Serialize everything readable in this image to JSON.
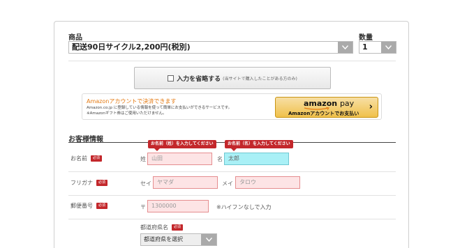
{
  "product": {
    "label": "商品",
    "selected": "配送90日サイクル2,200円(税別)"
  },
  "quantity": {
    "label": "数量",
    "selected": "1"
  },
  "skip": {
    "label": "入力を省略する",
    "note": "(当サイトで購入したことがある方のみ)"
  },
  "amazon": {
    "title": "Amazonアカウントで決済できます",
    "desc1": "Amazon.co.jp に登録している情報を使って簡単にお支払いができるサービスです。",
    "desc2": "※Amazonギフト券はご使用いただけません。",
    "button_logo_a": "amazon",
    "button_logo_b": "pay",
    "button_sub": "Amazonアカウントでお支払い",
    "button_chevron": "›"
  },
  "customer": {
    "section_title": "お客様情報",
    "required_badge": "必須",
    "name": {
      "label": "お名前",
      "last_prefix": "姓",
      "last_placeholder": "山田",
      "first_prefix": "名",
      "first_value": "太郎",
      "tooltip_last": "お名前（姓）を入力してください",
      "tooltip_first": "お名前（名）を入力してください"
    },
    "kana": {
      "label": "フリガナ",
      "last_prefix": "セイ",
      "last_placeholder": "ヤマダ",
      "first_prefix": "メイ",
      "first_placeholder": "タロウ"
    },
    "zip": {
      "label": "郵便番号",
      "prefix": "〒",
      "placeholder": "1300000",
      "hint": "※ハイフンなしで入力"
    },
    "prefecture": {
      "label": "都道府県名",
      "selected": "都道府県を選択"
    }
  },
  "colors": {
    "required_red": "#c3272b",
    "error_field_bg": "#fde4e5",
    "focused_field_bg": "#a9f0f6",
    "amazon_orange": "#e47911",
    "amazon_button": "#f0c14b"
  }
}
